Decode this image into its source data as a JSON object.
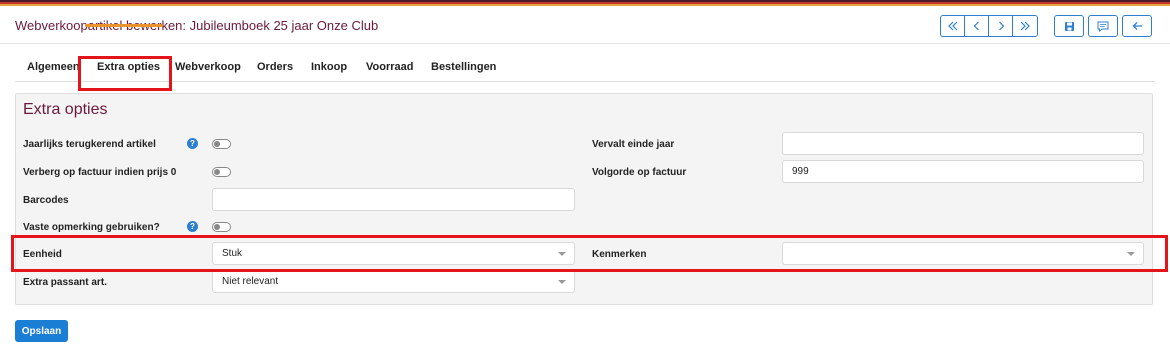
{
  "header": {
    "title": "Webverkoopartikel bewerken: Jubileumboek 25 jaar Onze Club"
  },
  "nav_icons": [
    "first-page-icon",
    "previous-icon",
    "next-icon",
    "last-page-icon",
    "save-icon",
    "comment-icon",
    "back-arrow-icon"
  ],
  "tabs": [
    {
      "label": "Algemeen"
    },
    {
      "label": "Extra opties",
      "active": true
    },
    {
      "label": "Webverkoop"
    },
    {
      "label": "Orders"
    },
    {
      "label": "Inkoop"
    },
    {
      "label": "Voorraad"
    },
    {
      "label": "Bestellingen"
    }
  ],
  "panel": {
    "title": "Extra opties",
    "fields": {
      "jaarlijks": {
        "label": "Jaarlijks terugkerend artikel",
        "help": "?",
        "value": false
      },
      "verberg": {
        "label": "Verberg op factuur indien prijs 0",
        "value": false
      },
      "barcodes": {
        "label": "Barcodes",
        "value": ""
      },
      "vaste_opmerking": {
        "label": "Vaste opmerking gebruiken?",
        "help": "?",
        "value": false
      },
      "eenheid": {
        "label": "Eenheid",
        "value": "Stuk"
      },
      "extra_passant": {
        "label": "Extra passant art.",
        "value": "Niet relevant"
      },
      "vervalt": {
        "label": "Vervalt einde jaar",
        "value": ""
      },
      "volgorde": {
        "label": "Volgorde op factuur",
        "value": "999"
      },
      "kenmerken": {
        "label": "Kenmerken",
        "value": ""
      }
    }
  },
  "actions": {
    "save_label": "Opslaan"
  },
  "colors": {
    "brand": "#6b1a3d",
    "accent": "#2f7fd1",
    "tab_underline": "#e8942a",
    "highlight": "#e3151a",
    "primary_button": "#1a7fd4"
  }
}
